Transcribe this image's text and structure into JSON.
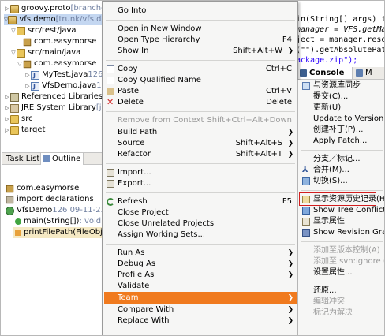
{
  "package_explorer": {
    "rows": [
      {
        "label": "groovy.proto",
        "suffix": " [branches/gri"
      },
      {
        "label": "vfs.demo",
        "suffix": " [trunk/vfs.demo"
      },
      {
        "label": "src/test/java",
        "suffix": ""
      },
      {
        "label": "com.easymorse",
        "suffix": ""
      },
      {
        "label": "src/main/java",
        "suffix": ""
      },
      {
        "label": "com.easymorse",
        "suffix": ""
      },
      {
        "label": "MyTest.java",
        "suffix": " 126"
      },
      {
        "label": "VfsDemo.java",
        "suffix": " 126"
      },
      {
        "label": "Referenced Libraries",
        "suffix": ""
      },
      {
        "label": "JRE System Library",
        "suffix": " [jav"
      },
      {
        "label": "src",
        "suffix": ""
      },
      {
        "label": "target",
        "suffix": ""
      }
    ]
  },
  "view_tabs": {
    "task_list": "Task List",
    "outline": "Outline"
  },
  "outline": {
    "rows": [
      {
        "label": "com.easymorse",
        "suffix": ""
      },
      {
        "label": "import declarations",
        "suffix": ""
      },
      {
        "label": "VfsDemo",
        "suffix": " 126  09-11-23  "
      },
      {
        "label": "main(String[])",
        "suffix": " : void"
      },
      {
        "label": "printFilePath(FileObjec",
        "suffix": ""
      }
    ]
  },
  "editor": {
    "lines": [
      {
        "text": "in(String[] args) th"
      },
      {
        "text": " manager = VFS.getMa"
      },
      {
        "text": "ject = manager.resol"
      },
      {
        "text": "(\"\").getAbsolutePat"
      },
      {
        "text": "ackage.zip\");"
      }
    ]
  },
  "console_tabs": {
    "console": "Console",
    "other": "M"
  },
  "context_menu": {
    "items": [
      {
        "label": "Go Into",
        "accel": "",
        "sub": false,
        "icon": "",
        "disabled": false
      },
      {
        "label": "Open in New Window",
        "accel": "",
        "sub": false,
        "icon": "",
        "disabled": false
      },
      {
        "label": "Open Type Hierarchy",
        "accel": "F4",
        "sub": false,
        "icon": "",
        "disabled": false
      },
      {
        "label": "Show In",
        "accel": "Shift+Alt+W",
        "sub": true,
        "icon": "",
        "disabled": false
      },
      {
        "label": "Copy",
        "accel": "Ctrl+C",
        "sub": false,
        "icon": "copy-icon",
        "disabled": false
      },
      {
        "label": "Copy Qualified Name",
        "accel": "",
        "sub": false,
        "icon": "copy-icon",
        "disabled": false
      },
      {
        "label": "Paste",
        "accel": "Ctrl+V",
        "sub": false,
        "icon": "paste-icon",
        "disabled": false
      },
      {
        "label": "Delete",
        "accel": "Delete",
        "sub": false,
        "icon": "delete-icon",
        "disabled": false
      },
      {
        "label": "Remove from Context",
        "accel": "Shift+Ctrl+Alt+Down",
        "sub": false,
        "icon": "",
        "disabled": true
      },
      {
        "label": "Build Path",
        "accel": "",
        "sub": true,
        "icon": "",
        "disabled": false
      },
      {
        "label": "Source",
        "accel": "Shift+Alt+S",
        "sub": true,
        "icon": "",
        "disabled": false
      },
      {
        "label": "Refactor",
        "accel": "Shift+Alt+T",
        "sub": true,
        "icon": "",
        "disabled": false
      },
      {
        "label": "Import...",
        "accel": "",
        "sub": false,
        "icon": "import-icon",
        "disabled": false
      },
      {
        "label": "Export...",
        "accel": "",
        "sub": false,
        "icon": "export-icon",
        "disabled": false
      },
      {
        "label": "Refresh",
        "accel": "F5",
        "sub": false,
        "icon": "refresh-icon",
        "disabled": false
      },
      {
        "label": "Close Project",
        "accel": "",
        "sub": false,
        "icon": "",
        "disabled": false
      },
      {
        "label": "Close Unrelated Projects",
        "accel": "",
        "sub": false,
        "icon": "",
        "disabled": false
      },
      {
        "label": "Assign Working Sets...",
        "accel": "",
        "sub": false,
        "icon": "",
        "disabled": false
      },
      {
        "label": "Run As",
        "accel": "",
        "sub": true,
        "icon": "",
        "disabled": false
      },
      {
        "label": "Debug As",
        "accel": "",
        "sub": true,
        "icon": "",
        "disabled": false
      },
      {
        "label": "Profile As",
        "accel": "",
        "sub": true,
        "icon": "",
        "disabled": false
      },
      {
        "label": "Validate",
        "accel": "",
        "sub": false,
        "icon": "",
        "disabled": false
      },
      {
        "label": "Team",
        "accel": "",
        "sub": true,
        "icon": "",
        "disabled": false
      },
      {
        "label": "Compare With",
        "accel": "",
        "sub": true,
        "icon": "",
        "disabled": false
      },
      {
        "label": "Replace With",
        "accel": "",
        "sub": true,
        "icon": "",
        "disabled": false
      }
    ]
  },
  "team_submenu": {
    "items": [
      {
        "label": "与资源库同步",
        "icon": "sync-icon",
        "disabled": false
      },
      {
        "label": "提交(C)...",
        "icon": "",
        "disabled": false
      },
      {
        "label": "更新(U)",
        "icon": "",
        "disabled": false
      },
      {
        "label": "Update to Version...",
        "icon": "",
        "disabled": false
      },
      {
        "label": "创建补丁(P)...",
        "icon": "",
        "disabled": false
      },
      {
        "label": "Apply Patch...",
        "icon": "",
        "disabled": false
      },
      {
        "label": "分支／标记...",
        "icon": "",
        "disabled": false
      },
      {
        "label": "合并(M)...",
        "icon": "merge-icon",
        "disabled": false
      },
      {
        "label": "切换(S)...",
        "icon": "switch-icon",
        "disabled": false
      },
      {
        "label": "显示资源历史记录(H)",
        "icon": "history-icon",
        "disabled": false
      },
      {
        "label": "Show Tree Conflicts",
        "icon": "tree-conflicts-icon",
        "disabled": false
      },
      {
        "label": "显示属性",
        "icon": "properties-icon",
        "disabled": false
      },
      {
        "label": "Show Revision Grap",
        "icon": "revision-graph-icon",
        "disabled": false
      },
      {
        "label": "添加至版本控制(A)",
        "icon": "",
        "disabled": true
      },
      {
        "label": "添加至 svn:ignore (D)",
        "icon": "",
        "disabled": true
      },
      {
        "label": "设置属性...",
        "icon": "",
        "disabled": false
      },
      {
        "label": "还原...",
        "icon": "",
        "disabled": false
      },
      {
        "label": "编辑冲突",
        "icon": "",
        "disabled": true
      },
      {
        "label": "标记为解决",
        "icon": "",
        "disabled": true
      }
    ]
  },
  "colors": {
    "highlight": "#f07a1e",
    "annotation_box": "#d21e1e",
    "menu_bg": "#f6f6f5"
  }
}
